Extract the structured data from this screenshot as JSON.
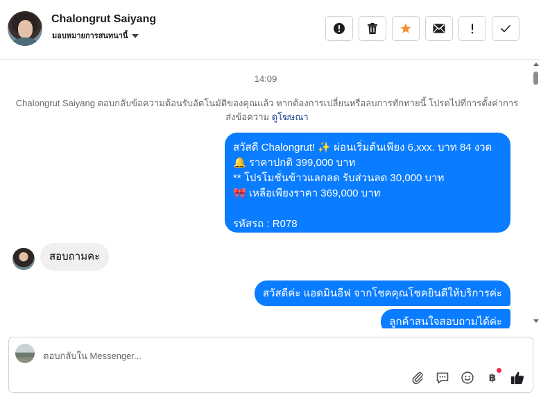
{
  "header": {
    "contact_name": "Chalongrut Saiyang",
    "assign_label": "มอบหมายการสนทนานี้",
    "actions": [
      {
        "name": "spam-button",
        "icon": "exclamation-circle-icon"
      },
      {
        "name": "delete-button",
        "icon": "trash-icon"
      },
      {
        "name": "star-button",
        "icon": "star-icon",
        "color": "#f7923b"
      },
      {
        "name": "mark-unread-button",
        "icon": "envelope-icon"
      },
      {
        "name": "follow-up-button",
        "icon": "exclamation-icon"
      },
      {
        "name": "mark-done-button",
        "icon": "check-icon"
      }
    ]
  },
  "thread": {
    "timestamp": "14:09",
    "auto_reply_note": "Chalongrut Saiyang ตอบกลับข้อความต้อนรับอัตโนมัติของคุณแล้ว หากต้องการเปลี่ยนหรือลบการทักทายนี้ โปรดไปที่การตั้งค่าการส่งข้อความ",
    "auto_reply_link": "ดูโฆษณา",
    "messages": [
      {
        "direction": "outgoing",
        "lines": [
          "สวัสดี Chalongrut! ✨  ผ่อนเริ่มต้นเพียง 6,xxx. บาท 84 งวด",
          "🔔 ราคาปกติ 399,000 บาท",
          "** โปรโมชั่นข้าวแลกลด รับส่วนลด 30,000 บาท",
          "🎀  เหลือเพียงราคา 369,000 บาท",
          "",
          "รหัสรถ : R078"
        ]
      },
      {
        "direction": "incoming",
        "text": "สอบถามคะ"
      },
      {
        "direction": "outgoing",
        "text": "สวัสดีค่ะ แอดมินอีฟ จากโชคคุณโชคยินดีให้บริการค่ะ"
      },
      {
        "direction": "outgoing",
        "text": "ลูกค้าสนใจสอบถามได้ค่ะ"
      }
    ],
    "bubble_color": "#0a7cff"
  },
  "composer": {
    "placeholder": "ตอบกลับใน Messenger...",
    "icons": [
      "paperclip-icon",
      "saved-reply-icon",
      "emoji-icon",
      "baht-payment-icon",
      "like-icon"
    ]
  }
}
